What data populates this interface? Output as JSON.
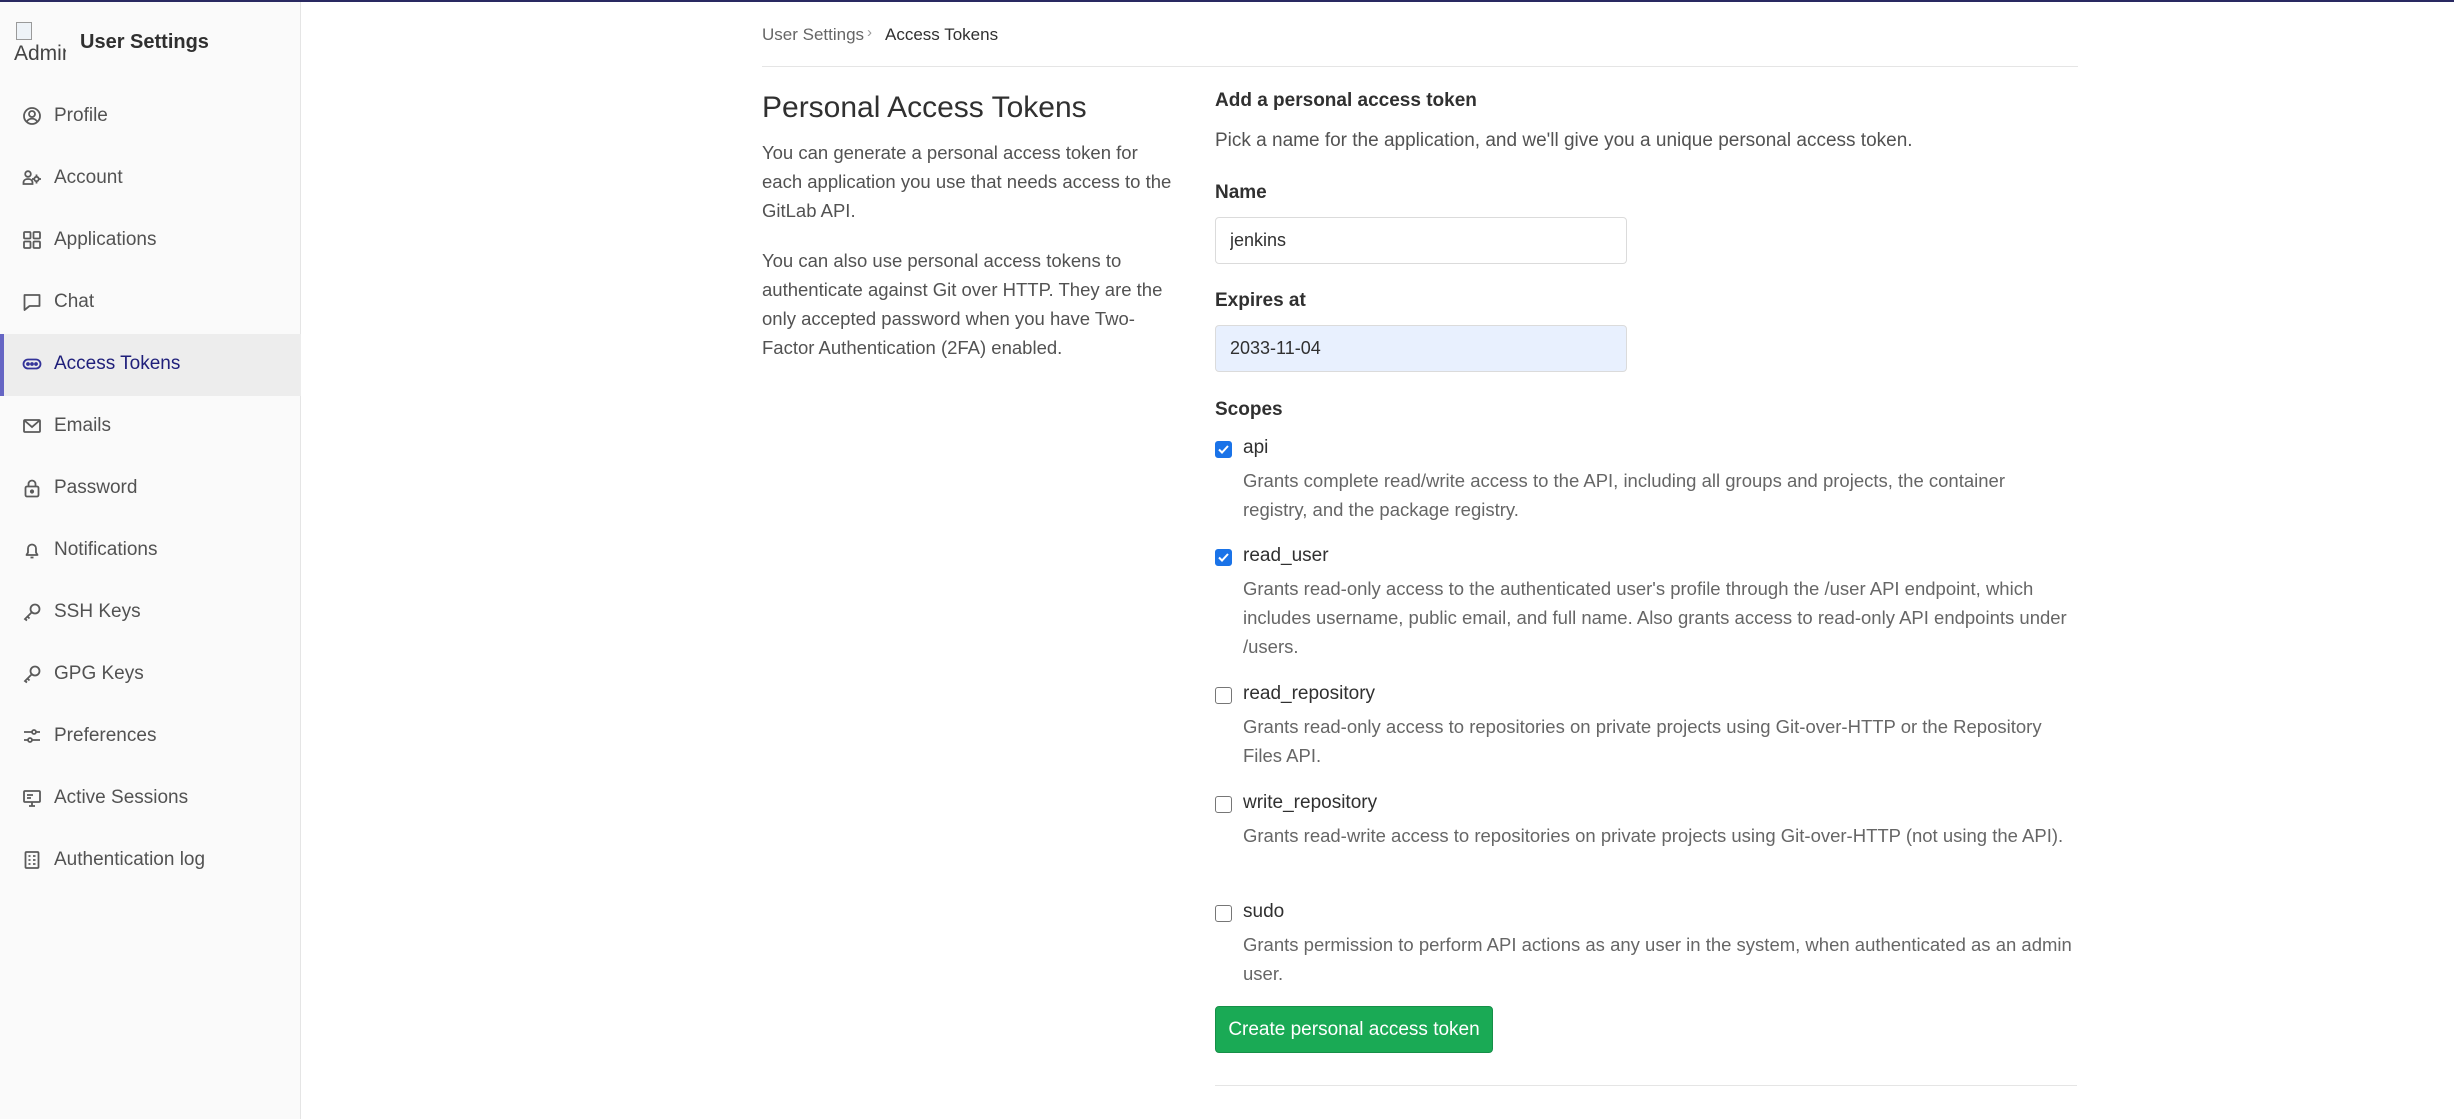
{
  "sidebar": {
    "avatar_alt": "Admin",
    "title": "User Settings",
    "items": [
      {
        "label": "Profile",
        "icon": "profile-icon"
      },
      {
        "label": "Account",
        "icon": "account-icon"
      },
      {
        "label": "Applications",
        "icon": "applications-icon"
      },
      {
        "label": "Chat",
        "icon": "chat-icon"
      },
      {
        "label": "Access Tokens",
        "icon": "token-icon",
        "active": true
      },
      {
        "label": "Emails",
        "icon": "mail-icon"
      },
      {
        "label": "Password",
        "icon": "lock-icon"
      },
      {
        "label": "Notifications",
        "icon": "bell-icon"
      },
      {
        "label": "SSH Keys",
        "icon": "key-icon"
      },
      {
        "label": "GPG Keys",
        "icon": "key-icon"
      },
      {
        "label": "Preferences",
        "icon": "preferences-icon"
      },
      {
        "label": "Active Sessions",
        "icon": "monitor-icon"
      },
      {
        "label": "Authentication log",
        "icon": "log-icon"
      }
    ]
  },
  "breadcrumb": {
    "parent": "User Settings",
    "current": "Access Tokens"
  },
  "info": {
    "title": "Personal Access Tokens",
    "paragraph1": "You can generate a personal access token for each application you use that needs access to the GitLab API.",
    "paragraph2": "You can also use personal access tokens to authenticate against Git over HTTP. They are the only accepted password when you have Two-Factor Authentication (2FA) enabled."
  },
  "form": {
    "heading": "Add a personal access token",
    "subheading": "Pick a name for the application, and we'll give you a unique personal access token.",
    "name_label": "Name",
    "name_value": "jenkins",
    "expires_label": "Expires at",
    "expires_value": "2033-11-04",
    "scopes_label": "Scopes",
    "scopes": [
      {
        "name": "api",
        "checked": true,
        "description": "Grants complete read/write access to the API, including all groups and projects, the container registry, and the package registry."
      },
      {
        "name": "read_user",
        "checked": true,
        "description": "Grants read-only access to the authenticated user's profile through the /user API endpoint, which includes username, public email, and full name. Also grants access to read-only API endpoints under /users."
      },
      {
        "name": "read_repository",
        "checked": false,
        "description": "Grants read-only access to repositories on private projects using Git-over-HTTP or the Repository Files API."
      },
      {
        "name": "write_repository",
        "checked": false,
        "description": "Grants read-write access to repositories on private projects using Git-over-HTTP (not using the API)."
      },
      {
        "name": "sudo",
        "checked": false,
        "description": "Grants permission to perform API actions as any user in the system, when authenticated as an admin user."
      }
    ],
    "submit_label": "Create personal access token"
  },
  "colors": {
    "accent": "#6666c4",
    "button": "#1aaa55",
    "checkbox": "#1a73e8",
    "topbar": "#292961"
  }
}
